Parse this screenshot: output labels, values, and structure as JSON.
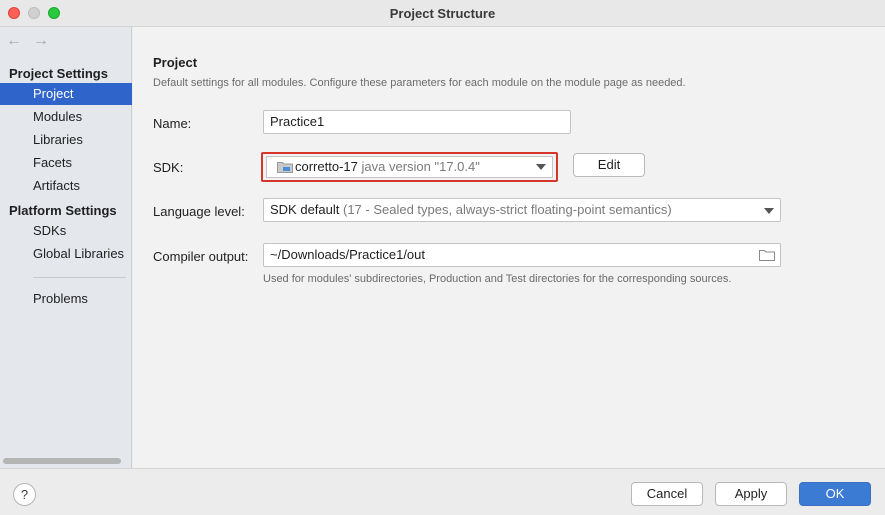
{
  "window": {
    "title": "Project Structure"
  },
  "nav": {
    "back_glyph": "←",
    "forward_glyph": "→"
  },
  "sidebar": {
    "project_settings_heading": "Project Settings",
    "project_items": [
      "Project",
      "Modules",
      "Libraries",
      "Facets",
      "Artifacts"
    ],
    "platform_settings_heading": "Platform Settings",
    "platform_items": [
      "SDKs",
      "Global Libraries"
    ],
    "other_items": [
      "Problems"
    ],
    "selected": "Project"
  },
  "project": {
    "title": "Project",
    "description": "Default settings for all modules. Configure these parameters for each module on the module page as needed.",
    "name_label": "Name:",
    "name_value": "Practice1",
    "sdk_label": "SDK:",
    "sdk_name": "corretto-17",
    "sdk_version": "java version \"17.0.4\"",
    "edit_label": "Edit",
    "language_level_label": "Language level:",
    "language_level_value": "SDK default",
    "language_level_detail": "(17 - Sealed types, always-strict floating-point semantics)",
    "compiler_output_label": "Compiler output:",
    "compiler_output_value": "~/Downloads/Practice1/out",
    "compiler_output_hint": "Used for modules' subdirectories, Production and Test directories for the corresponding sources."
  },
  "footer": {
    "help_label": "?",
    "cancel_label": "Cancel",
    "apply_label": "Apply",
    "ok_label": "OK"
  },
  "colors": {
    "selection": "#2f65ca",
    "highlight_border": "#d8352a",
    "ok_button": "#3c7bd4"
  },
  "icons": [
    "back-arrow-icon",
    "forward-arrow-icon",
    "folder-icon",
    "chevron-down-icon",
    "help-icon"
  ]
}
